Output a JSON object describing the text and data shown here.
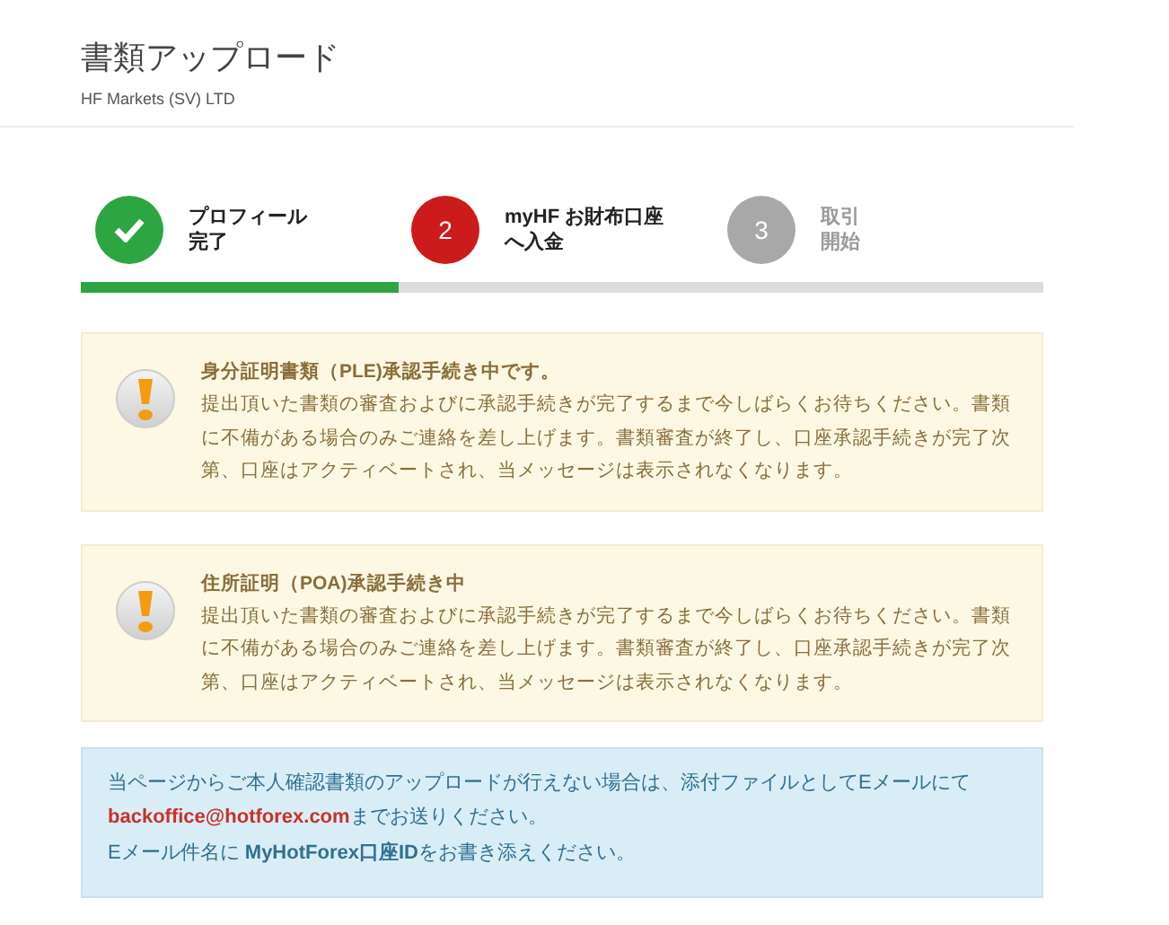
{
  "header": {
    "title": "書類アップロード",
    "subtitle": "HF Markets (SV) LTD"
  },
  "steps": [
    {
      "kind": "done",
      "lines": [
        "プロフィール",
        "完了"
      ]
    },
    {
      "kind": "current",
      "marker": "2",
      "lines": [
        "myHF お財布口座",
        "へ入金"
      ]
    },
    {
      "kind": "pending",
      "marker": "3",
      "lines": [
        "取引",
        "開始"
      ]
    }
  ],
  "progress": {
    "level": 0.33
  },
  "alerts": [
    {
      "title": "身分証明書類（PLE)承認手続き中です。",
      "body": "提出頂いた書類の審査およびに承認手続きが完了するまで今しばらくお待ちください。書類に不備がある場合のみご連絡を差し上げます。書類審査が終了し、口座承認手続きが完了次第、口座はアクティベートされ、当メッセージは表示されなくなります。"
    },
    {
      "title": "住所証明（POA)承認手続き中",
      "body": "提出頂いた書類の審査およびに承認手続きが完了するまで今しばらくお待ちください。書類に不備がある場合のみご連絡を差し上げます。書類審査が終了し、口座承認手続きが完了次第、口座はアクティベートされ、当メッセージは表示されなくなります。"
    }
  ],
  "info": {
    "line1": "当ページからご本人確認書類のアップロードが行えない場合は、添付ファイルとしてEメールにて",
    "email": "backoffice@hotforex.com",
    "after_email": "までお送りください。",
    "line3": "Eメール件名に **MyHotForex口座ID**をお書き添えください。"
  }
}
